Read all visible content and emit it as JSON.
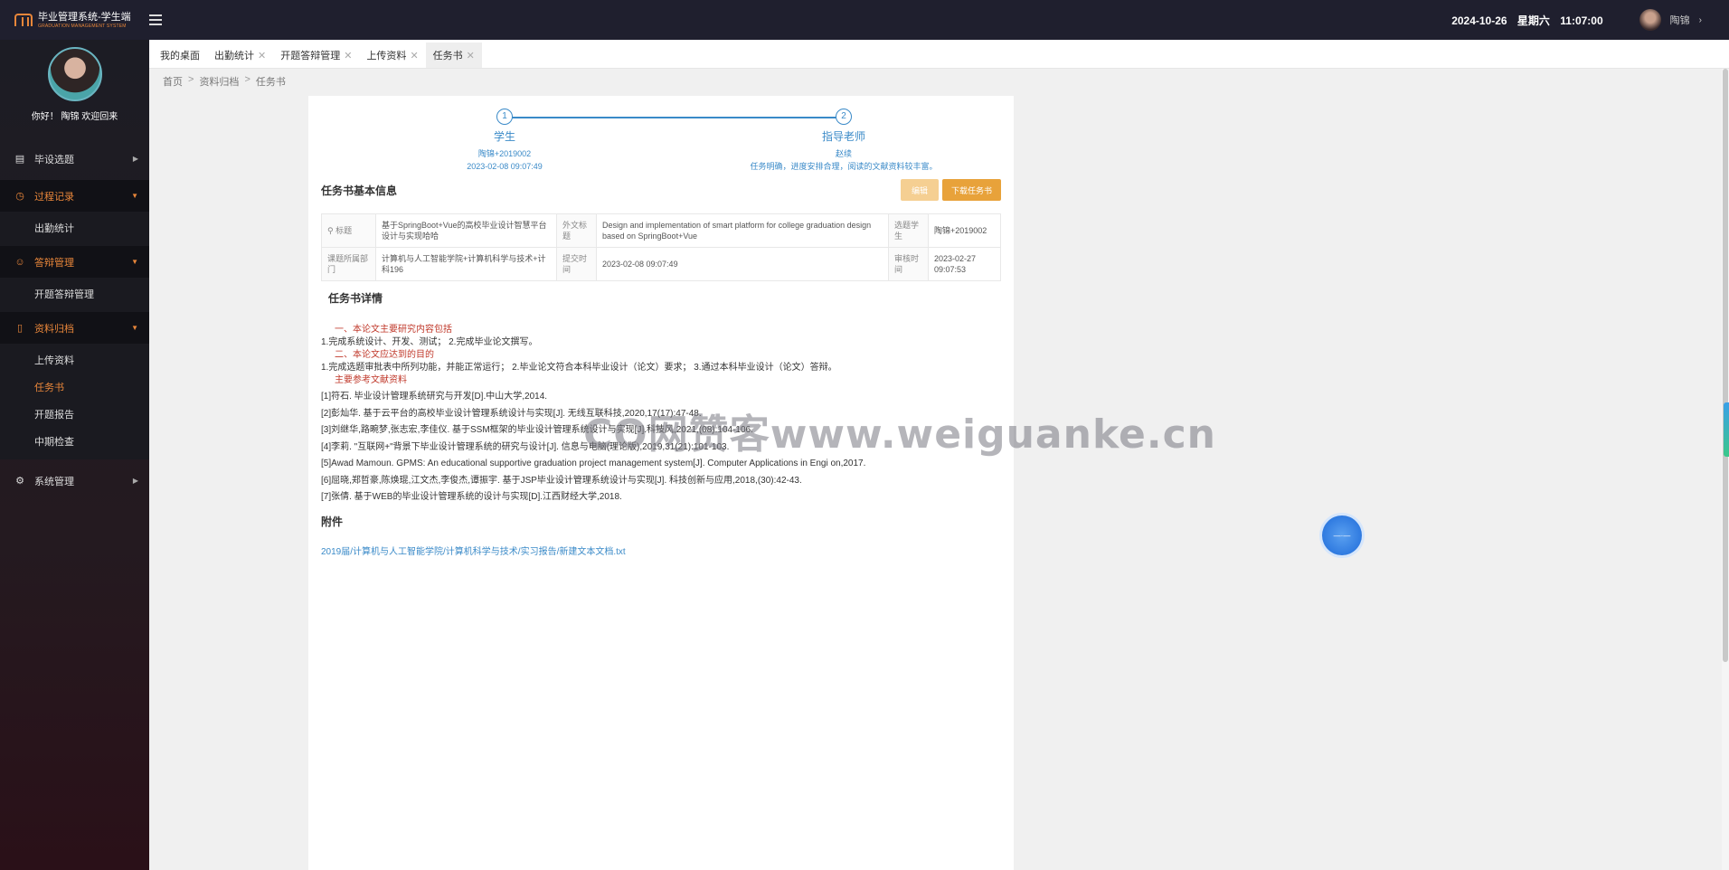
{
  "header": {
    "app_title": "毕业管理系统-学生端",
    "app_subtitle": "GRADUATION MANAGEMENT SYSTEM",
    "date": "2024-10-26",
    "weekday": "星期六",
    "time": "11:07:00",
    "user_name": "陶锦"
  },
  "sidebar": {
    "greeting": "你好！ 陶锦 欢迎回来",
    "menus": [
      {
        "label": "毕设选题",
        "icon": "document-icon",
        "expanded": false,
        "items": []
      },
      {
        "label": "过程记录",
        "icon": "clock-icon",
        "expanded": true,
        "items": [
          {
            "label": "出勤统计"
          }
        ]
      },
      {
        "label": "答辩管理",
        "icon": "chat-icon",
        "expanded": true,
        "items": [
          {
            "label": "开题答辩管理"
          }
        ]
      },
      {
        "label": "资料归档",
        "icon": "file-icon",
        "expanded": true,
        "items": [
          {
            "label": "上传资料"
          },
          {
            "label": "任务书"
          },
          {
            "label": "开题报告"
          },
          {
            "label": "中期检查"
          }
        ]
      },
      {
        "label": "系统管理",
        "icon": "gear-icon",
        "expanded": false,
        "items": []
      }
    ]
  },
  "tabs": [
    {
      "label": "我的桌面",
      "closable": false
    },
    {
      "label": "出勤统计",
      "closable": true
    },
    {
      "label": "开题答辩管理",
      "closable": true
    },
    {
      "label": "上传资料",
      "closable": true
    },
    {
      "label": "任务书",
      "closable": true,
      "active": true
    }
  ],
  "breadcrumb": [
    "首页",
    "资料归档",
    "任务书"
  ],
  "steps": [
    {
      "num": "1",
      "title": "学生",
      "lines": [
        "陶锦+2019002",
        "2023-02-08 09:07:49"
      ]
    },
    {
      "num": "2",
      "title": "指导老师",
      "lines": [
        "赵续",
        "任务明确，进度安排合理，阅读的文献资料较丰富。"
      ]
    }
  ],
  "basic_info": {
    "title": "任务书基本信息",
    "edit_label": "编辑",
    "download_label": "下载任务书",
    "rows": [
      [
        {
          "label": "标题",
          "value": "基于SpringBoot+Vue的高校毕业设计智慧平台设计与实现哈哈"
        },
        {
          "label": "外文标题",
          "value": "Design and implementation of smart platform for college graduation design based on SpringBoot+Vue"
        },
        {
          "label": "选题学生",
          "value": "陶锦+2019002"
        }
      ],
      [
        {
          "label": "课题所属部门",
          "value": "计算机与人工智能学院+计算机科学与技术+计科196"
        },
        {
          "label": "提交时间",
          "value": "2023-02-08 09:07:49"
        },
        {
          "label": "审核时间",
          "value": "2023-02-27 09:07:53"
        }
      ]
    ]
  },
  "detail": {
    "title": "任务书详情",
    "h1": "一、本论文主要研究内容包括",
    "p1": "1.完成系统设计、开发、测试； 2.完成毕业论文撰写。",
    "h2": "二、本论文应达到的目的",
    "p2": "1.完成选题审批表中所列功能，并能正常运行； 2.毕业论文符合本科毕业设计（论文）要求； 3.通过本科毕业设计（论文）答辩。",
    "h3": "主要参考文献资料",
    "refs": [
      "[1]符石. 毕业设计管理系统研究与开发[D].中山大学,2014.",
      "[2]彭灿华. 基于云平台的高校毕业设计管理系统设计与实现[J]. 无线互联科技,2020,17(17):47-48.",
      "[3]刘继华,路畹梦,张志宏,李佳仪. 基于SSM框架的毕业设计管理系统设计与实现[J].科技风,2021,(08):104-106.",
      "[4]李莉. \"互联网+\"背景下毕业设计管理系统的研究与设计[J]. 信息与电脑(理论版),2019,31(21):101-103.",
      "[5]Awad Mamoun. GPMS: An educational supportive graduation project management system[J]. Computer Applications in Engi on,2017.",
      "[6]屈晓,郑哲豪,陈焕琨,江文杰,李俊杰,谭振宇. 基于JSP毕业设计管理系统设计与实现[J]. 科技创新与应用,2018,(30):42-43.",
      "[7]张倩. 基于WEB的毕业设计管理系统的设计与实现[D].江西财经大学,2018."
    ]
  },
  "attachment": {
    "title": "附件",
    "link": "2019届/计算机与人工智能学院/计算机科学与技术/实习报告/新建文本文档.txt"
  },
  "watermark": "CO网赞客www.weiguanke.cn",
  "float_button": "—·—"
}
